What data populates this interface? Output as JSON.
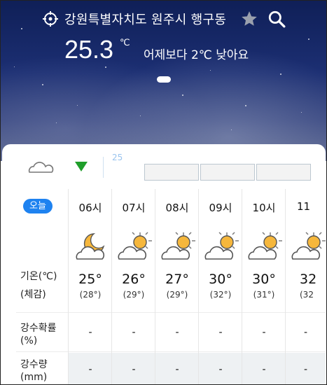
{
  "header": {
    "location": "강원특별자치도 원주시 행구동",
    "temperature": "25.3",
    "temperature_unit": "℃",
    "comparison": "어제보다 2℃ 낮아요",
    "icons": [
      "gps-icon",
      "star-icon",
      "search-icon"
    ]
  },
  "forecast": {
    "today_label": "오늘",
    "strip_partial_text": "25",
    "labels": {
      "temp": "기온(℃)",
      "feels": "(체감)",
      "precip_prob_1": "강수확률",
      "precip_prob_2": "(%)",
      "precip_amt_1": "강수량",
      "precip_amt_2": "(mm)"
    },
    "hours": [
      {
        "time": "06시",
        "icon": "moon-cloud-icon",
        "temp": "25°",
        "feels": "(28°)",
        "precip_prob": "-",
        "precip_amt": "-"
      },
      {
        "time": "07시",
        "icon": "sun-cloud-icon",
        "temp": "26°",
        "feels": "(29°)",
        "precip_prob": "-",
        "precip_amt": "-"
      },
      {
        "time": "08시",
        "icon": "sun-cloud-icon",
        "temp": "27°",
        "feels": "(29°)",
        "precip_prob": "-",
        "precip_amt": "-"
      },
      {
        "time": "09시",
        "icon": "sun-cloud-icon",
        "temp": "30°",
        "feels": "(32°)",
        "precip_prob": "-",
        "precip_amt": "-"
      },
      {
        "time": "10시",
        "icon": "sun-cloud-icon",
        "temp": "30°",
        "feels": "(31°)",
        "precip_prob": "-",
        "precip_amt": "-"
      },
      {
        "time": "11",
        "icon": "sun-cloud-icon",
        "temp": "32",
        "feels": "(32",
        "precip_prob": "-",
        "precip_amt": "-"
      }
    ],
    "colors": {
      "today_badge": "#1e82f0",
      "indicator": "#1f9e2a"
    }
  }
}
